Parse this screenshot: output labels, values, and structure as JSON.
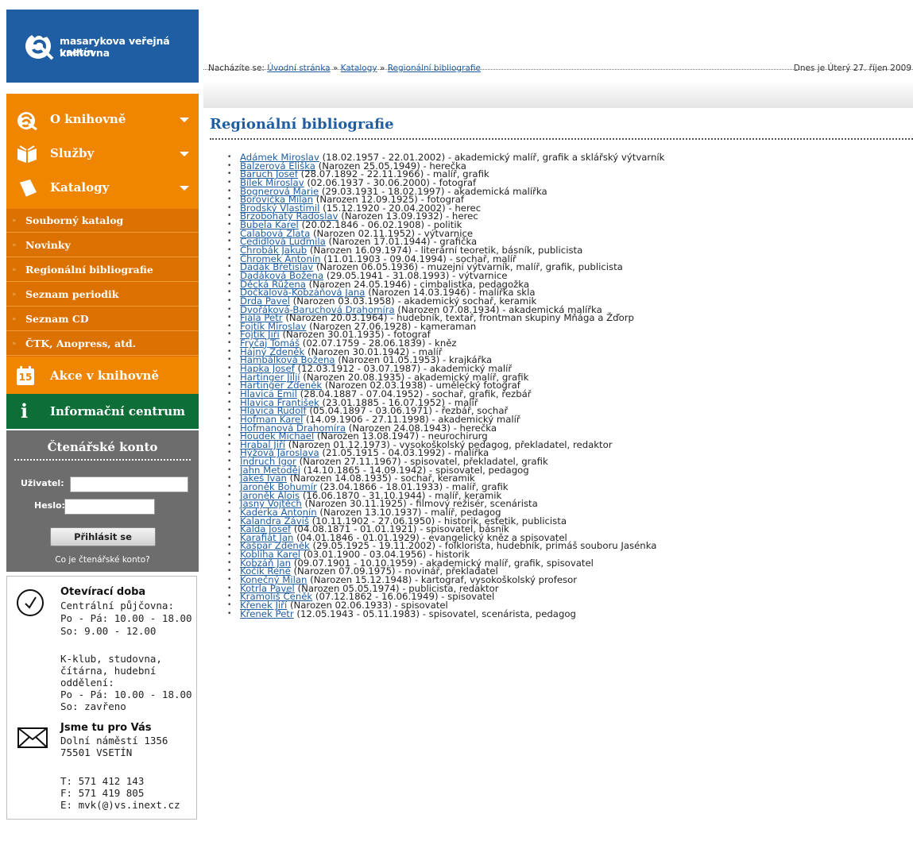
{
  "brand": {
    "line1": "masarykova veřejná knihovna",
    "line2": "vsetín"
  },
  "nav": {
    "main": [
      {
        "label": "O knihovně"
      },
      {
        "label": "Služby"
      },
      {
        "label": "Katalogy"
      }
    ],
    "sub": [
      {
        "label": "Souborný katalog"
      },
      {
        "label": "Novinky"
      },
      {
        "label": "Regionální bibliografie"
      },
      {
        "label": "Seznam periodik"
      },
      {
        "label": "Seznam CD"
      },
      {
        "label": "ČTK, Anopress, atd."
      }
    ],
    "akce": {
      "label": "Akce v knihovně",
      "day": "15"
    },
    "info": {
      "label": "Informační centrum",
      "icon": "i"
    }
  },
  "konto": {
    "title": "Čtenářské konto",
    "user_label": "Uživatel:",
    "pass_label": "Heslo:",
    "user_value": "",
    "pass_value": "",
    "login_button": "Přihlásit se",
    "help_link": "Co je čtenářské konto?"
  },
  "hours": {
    "title": "Otevírací doba",
    "lines": [
      "Centrální půjčovna:",
      "Po - Pá: 10.00 - 18.00",
      "So: 9.00 - 12.00",
      "",
      "K-klub, studovna,",
      "čítárna, hudební",
      "oddělení:",
      "Po - Pá: 10.00 - 18.00",
      "So: zavřeno"
    ]
  },
  "contact": {
    "title": "Jsme tu pro Vás",
    "lines": [
      "Dolní náměstí 1356",
      "75501 VSETÍN",
      "",
      "T: 571 412 143",
      "F: 571 419 805",
      "E: mvk(@)vs.inext.cz"
    ]
  },
  "breadcrumb": {
    "prefix": "Nacházíte se:",
    "items": [
      "Úvodní stránka",
      "Katalogy",
      "Regionální bibliografie"
    ],
    "sep": "»"
  },
  "date_text": "Dnes je Úterý 27. říjen 2009",
  "page_title": "Regionální bibliografie",
  "people": [
    {
      "name": "Adámek Miroslav",
      "info": " (18.02.1957 - 22.01.2002) - akademický malíř, grafik a sklářský výtvarník"
    },
    {
      "name": "Balzerová Eliška",
      "info": " (Narozen 25.05.1949) - herečka"
    },
    {
      "name": "Baruch Josef",
      "info": " (28.07.1892 - 22.11.1966) - malíř, grafik"
    },
    {
      "name": "Bílek Miroslav",
      "info": " (02.06.1937 - 30.06.2000) - fotograf"
    },
    {
      "name": "Bognerová Marie",
      "info": " (29.03.1931 - 18.02.1997) - akademická malířka"
    },
    {
      "name": "Borovička Milan",
      "info": " (Narozen 12.09.1925) - fotograf"
    },
    {
      "name": "Brodský Vlastimil",
      "info": " (15.12.1920 - 20.04.2002) - herec"
    },
    {
      "name": "Brzobohatý Radoslav",
      "info": " (Narozen 13.09.1932) - herec"
    },
    {
      "name": "Bubela Karel",
      "info": " (20.02.1846 - 06.02.1908) - politik"
    },
    {
      "name": "Calabová Zlata",
      "info": " (Narozen 02.11.1952) - výtvarnice"
    },
    {
      "name": "Cedidlová Ludmila",
      "info": " (Narozen 17.01.1944) - grafička"
    },
    {
      "name": "Chrobák Jakub",
      "info": " (Narozen 16.09.1974) - literární teoretik, básník, publicista"
    },
    {
      "name": "Chromek Antonín",
      "info": " (11.01.1903 - 09.04.1994) - sochař, malíř"
    },
    {
      "name": "Dadák Břetislav",
      "info": " (Narozen 06.05.1936) - muzejní výtvarník, malíř, grafik, publicista"
    },
    {
      "name": "Dadáková Božena",
      "info": " (29.05.1941 - 31.08.1993) - výtvarnice"
    },
    {
      "name": "Děcká Růžena",
      "info": " (Narozen 24.05.1946) - cimbalistka, pedagožka"
    },
    {
      "name": "Dočkalová-Kobzáňová Jana",
      "info": " (Narozen 14.03.1946) - malířka skla"
    },
    {
      "name": "Drda Pavel",
      "info": " (Narozen 03.03.1958) - akademický sochař, keramik"
    },
    {
      "name": "Dvořáková-Baruchová Drahomíra",
      "info": " (Narozen 07.08.1934) - akademická malířka"
    },
    {
      "name": "Fiala Petr",
      "info": " (Narozen 20.03.1964) - hudebník, textař, frontman skupiny Mňága a Žďorp"
    },
    {
      "name": "Fojtík Miroslav",
      "info": " (Narozen 27.06.1928) - kameraman"
    },
    {
      "name": "Fojtík Jiří",
      "info": " (Narozen 30.01.1935) - fotograf"
    },
    {
      "name": "Fryčaj Tomáš",
      "info": " (02.07.1759 - 28.06.1839) - kněz"
    },
    {
      "name": "Hajný Zdeněk",
      "info": " (Narozen 30.01.1942) - malíř"
    },
    {
      "name": "Hambálková Božena",
      "info": " (Narozen 01.05.1953) - krajkářka"
    },
    {
      "name": "Hapka Josef",
      "info": " (12.03.1912 - 03.07.1987) - akademický malíř"
    },
    {
      "name": "Hartinger Jiljí",
      "info": " (Narozen 20.08.1935) - akademický malíř, grafik"
    },
    {
      "name": "Hartinger Zdeněk",
      "info": " (Narozen 02.03.1938) - umělecký fotograf"
    },
    {
      "name": "Hlavica Emil",
      "info": " (28.04.1887 - 07.04.1952) - sochař, grafik, řezbář"
    },
    {
      "name": "Hlavica František",
      "info": " (23.01.1885 - 16.07.1952) - malíř"
    },
    {
      "name": "Hlavica Rudolf",
      "info": " (05.04.1897 - 03.06.1971) - řezbář, sochař"
    },
    {
      "name": "Hofman Karel",
      "info": " (14.09.1906 - 27.11.1998) - akademický malíř"
    },
    {
      "name": "Hofmanová Drahomíra",
      "info": " (Narozen 24.08.1943) - herečka"
    },
    {
      "name": "Houdek Michael",
      "info": " (Narozen 13.08.1947) - neurochirurg"
    },
    {
      "name": "Hrabal Jiří",
      "info": " (Narozen 01.12.1973) - vysokoškolský pedagog, překladatel, redaktor"
    },
    {
      "name": "Hýžová Jaroslava",
      "info": " (21.05.1915 - 04.03.1992) - malířka"
    },
    {
      "name": "Indruch Igor",
      "info": " (Narozen 27.11.1967) - spisovatel, překladatel, grafik"
    },
    {
      "name": "Jahn Metoděj",
      "info": " (14.10.1865 - 14.09.1942) - spisovatel, pedagog"
    },
    {
      "name": "Jakeš Ivan",
      "info": " (Narozen 14.08.1935) - sochař, keramik"
    },
    {
      "name": "Jaroněk Bohumír",
      "info": " (23.04.1866 - 18.01.1933) - malíř, grafik"
    },
    {
      "name": "Jaroněk Alois",
      "info": " (16.06.1870 - 31.10.1944) - malíř, keramik"
    },
    {
      "name": "Jasný Vojtěch",
      "info": " (Narozen 30.11.1925) - filmový režisér, scenárista"
    },
    {
      "name": "Kaderka Antonín",
      "info": " (Narozen 13.10.1937) - malíř, pedagog"
    },
    {
      "name": "Kalandra Záviš",
      "info": " (10.11.1902 - 27.06.1950) - historik, estetik, publicista"
    },
    {
      "name": "Kalda Josef",
      "info": " (04.08.1871 - 01.01.1921) - spisovatel, básník"
    },
    {
      "name": "Karafiát Jan",
      "info": " (04.01.1846 - 01.01.1929) - evangelický kněz a spisovatel"
    },
    {
      "name": "Kašpar Zdeněk",
      "info": " (29.05.1925 - 19.11.2002) - folklorista, hudebník, primáš souboru Jasénka"
    },
    {
      "name": "Kobliha Karel",
      "info": " (03.01.1900 - 03.04.1956) - historik"
    },
    {
      "name": "Kobzáň Jan",
      "info": " (09.07.1901 - 10.10.1959) - akademický malíř, grafik, spisovatel"
    },
    {
      "name": "Kočík René",
      "info": " (Narozen 07.09.1975) - novinář, překladatel"
    },
    {
      "name": "Konečný Milan",
      "info": " (Narozen 15.12.1948) - kartograf, vysokoškolský profesor"
    },
    {
      "name": "Kotrla Pavel",
      "info": " (Narozen 05.05.1974) - publicista, redaktor"
    },
    {
      "name": "Kramoliš Čeněk",
      "info": " (07.12.1862 - 16.06.1949) - spisovatel"
    },
    {
      "name": "Křenek Jiří",
      "info": " (Narozen 02.06.1933) - spisovatel"
    },
    {
      "name": "Křenek Petr",
      "info": " (12.05.1943 - 05.11.1983) - spisovatel, scenárista, pedagog"
    }
  ]
}
